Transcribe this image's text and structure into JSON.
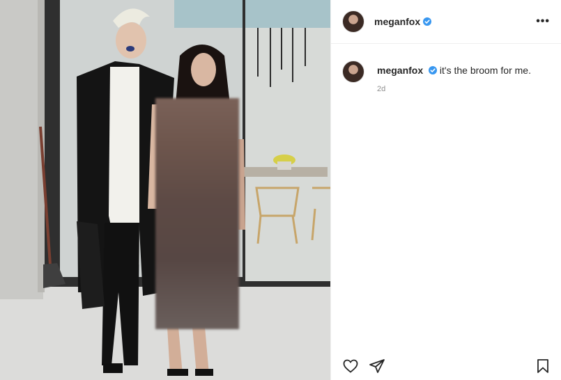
{
  "post": {
    "author": {
      "username": "meganfox",
      "verified": true,
      "avatar_icon": "profile-photo"
    },
    "caption": {
      "username": "meganfox",
      "text": "it's the broom for me."
    },
    "time_ago": "2d",
    "header_menu_icon": "more-dots-icon",
    "actions": {
      "like_icon": "heart-icon",
      "share_icon": "paper-plane-icon",
      "save_icon": "bookmark-icon"
    }
  },
  "colors": {
    "verified_blue": "#3897f0",
    "text": "#262626",
    "muted": "#8e8e8e",
    "divider": "#efefef"
  }
}
